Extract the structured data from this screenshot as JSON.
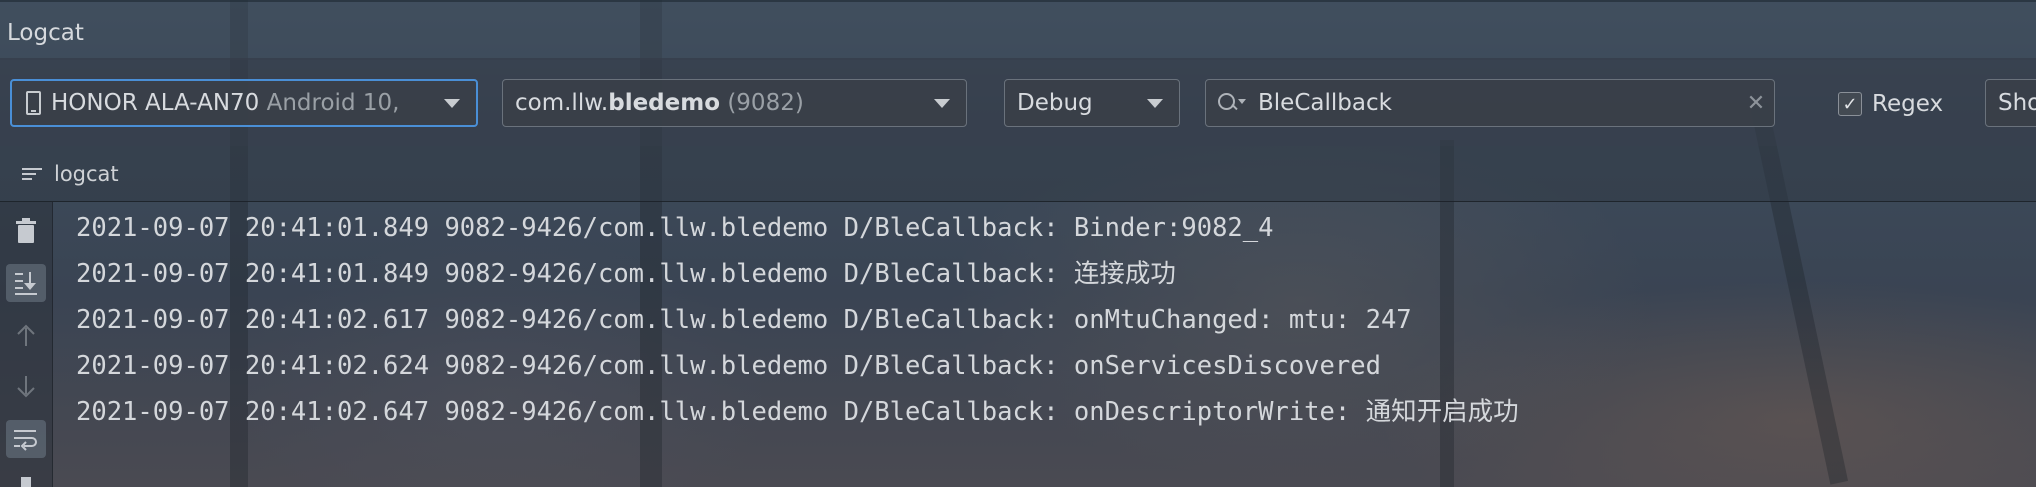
{
  "window": {
    "title": "Logcat"
  },
  "toolbar": {
    "device": {
      "name": "HONOR ALA-AN70",
      "detail": "Android 10,"
    },
    "process": {
      "prefix": "com.llw.",
      "package_bold": "bledemo",
      "pid": "(9082)"
    },
    "level": "Debug",
    "search": {
      "value": "BleCallback",
      "clear_icon": "✕"
    },
    "regex": {
      "label": "Regex",
      "checked": true
    },
    "show_button_label": "Sho"
  },
  "tabs": [
    {
      "label": "logcat"
    }
  ],
  "sidebar": {
    "icons": [
      "trash-icon",
      "scroll-to-end-icon",
      "up-arrow-icon",
      "down-arrow-icon",
      "soft-wrap-icon"
    ]
  },
  "log_lines": [
    "2021-09-07 20:41:01.849 9082-9426/com.llw.bledemo D/BleCallback: Binder:9082_4",
    "2021-09-07 20:41:01.849 9082-9426/com.llw.bledemo D/BleCallback: 连接成功",
    "2021-09-07 20:41:02.617 9082-9426/com.llw.bledemo D/BleCallback: onMtuChanged: mtu:  247",
    "2021-09-07 20:41:02.624 9082-9426/com.llw.bledemo D/BleCallback: onServicesDiscovered",
    "2021-09-07 20:41:02.647 9082-9426/com.llw.bledemo D/BleCallback: onDescriptorWrite: 通知开启成功"
  ],
  "colors": {
    "focus_border": "#4a8fd6",
    "text": "#d4d7db"
  }
}
